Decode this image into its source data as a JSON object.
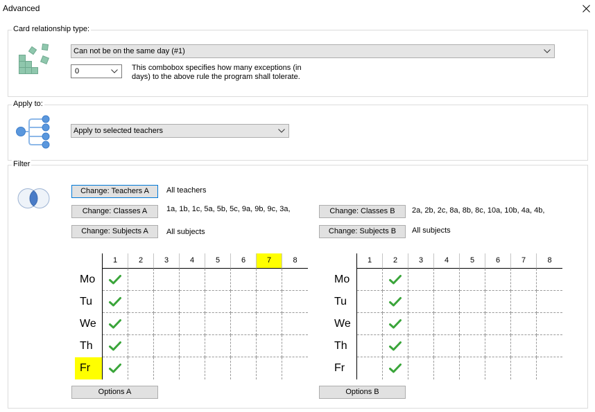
{
  "window": {
    "title": "Advanced"
  },
  "icons": {
    "close": "close-icon",
    "card_relationship": "cards-stack-icon",
    "apply_to": "tree-branch-icon",
    "filter": "venn-diagram-icon",
    "dropdown": "chevron-down-icon",
    "slot_checked": "checkmark-icon"
  },
  "colors": {
    "highlight": "#ffff00",
    "check": "#3aa53a",
    "focus_border": "#0078d7"
  },
  "card_relationship": {
    "legend": "Card relationship type:",
    "type_value": "Can not be on the same day (#1)",
    "exceptions_value": "0",
    "exceptions_help": "This combobox specifies how many exceptions (in days) to the above rule the program shall tolerate."
  },
  "apply_to": {
    "legend": "Apply to:",
    "value": "Apply to selected teachers"
  },
  "filter": {
    "legend": "Filter",
    "a": {
      "teachers_button": "Change: Teachers A",
      "teachers_value": "All teachers",
      "classes_button": "Change: Classes A",
      "classes_value": "1a, 1b, 1c, 5a, 5b, 5c, 9a, 9b, 9c, 3a,",
      "subjects_button": "Change: Subjects A",
      "subjects_value": "All subjects",
      "options_button": "Options A",
      "grid": {
        "periods": [
          {
            "label": "1",
            "highlighted": false
          },
          {
            "label": "2",
            "highlighted": false
          },
          {
            "label": "3",
            "highlighted": false
          },
          {
            "label": "4",
            "highlighted": false
          },
          {
            "label": "5",
            "highlighted": false
          },
          {
            "label": "6",
            "highlighted": false
          },
          {
            "label": "7",
            "highlighted": true
          },
          {
            "label": "8",
            "highlighted": false
          }
        ],
        "days": [
          {
            "label": "Mo",
            "highlighted": false,
            "checked": [
              true,
              false,
              false,
              false,
              false,
              false,
              false,
              false
            ]
          },
          {
            "label": "Tu",
            "highlighted": false,
            "checked": [
              true,
              false,
              false,
              false,
              false,
              false,
              false,
              false
            ]
          },
          {
            "label": "We",
            "highlighted": false,
            "checked": [
              true,
              false,
              false,
              false,
              false,
              false,
              false,
              false
            ]
          },
          {
            "label": "Th",
            "highlighted": false,
            "checked": [
              true,
              false,
              false,
              false,
              false,
              false,
              false,
              false
            ]
          },
          {
            "label": "Fr",
            "highlighted": true,
            "checked": [
              true,
              false,
              false,
              false,
              false,
              false,
              false,
              false
            ]
          }
        ]
      }
    },
    "b": {
      "classes_button": "Change: Classes B",
      "classes_value": "2a, 2b, 2c, 8a, 8b, 8c, 10a, 10b, 4a, 4b,",
      "subjects_button": "Change: Subjects B",
      "subjects_value": "All subjects",
      "options_button": "Options B",
      "grid": {
        "periods": [
          {
            "label": "1",
            "highlighted": false
          },
          {
            "label": "2",
            "highlighted": false
          },
          {
            "label": "3",
            "highlighted": false
          },
          {
            "label": "4",
            "highlighted": false
          },
          {
            "label": "5",
            "highlighted": false
          },
          {
            "label": "6",
            "highlighted": false
          },
          {
            "label": "7",
            "highlighted": false
          },
          {
            "label": "8",
            "highlighted": false
          }
        ],
        "days": [
          {
            "label": "Mo",
            "highlighted": false,
            "checked": [
              false,
              true,
              false,
              false,
              false,
              false,
              false,
              false
            ]
          },
          {
            "label": "Tu",
            "highlighted": false,
            "checked": [
              false,
              true,
              false,
              false,
              false,
              false,
              false,
              false
            ]
          },
          {
            "label": "We",
            "highlighted": false,
            "checked": [
              false,
              true,
              false,
              false,
              false,
              false,
              false,
              false
            ]
          },
          {
            "label": "Th",
            "highlighted": false,
            "checked": [
              false,
              true,
              false,
              false,
              false,
              false,
              false,
              false
            ]
          },
          {
            "label": "Fr",
            "highlighted": false,
            "checked": [
              false,
              true,
              false,
              false,
              false,
              false,
              false,
              false
            ]
          }
        ]
      }
    }
  }
}
